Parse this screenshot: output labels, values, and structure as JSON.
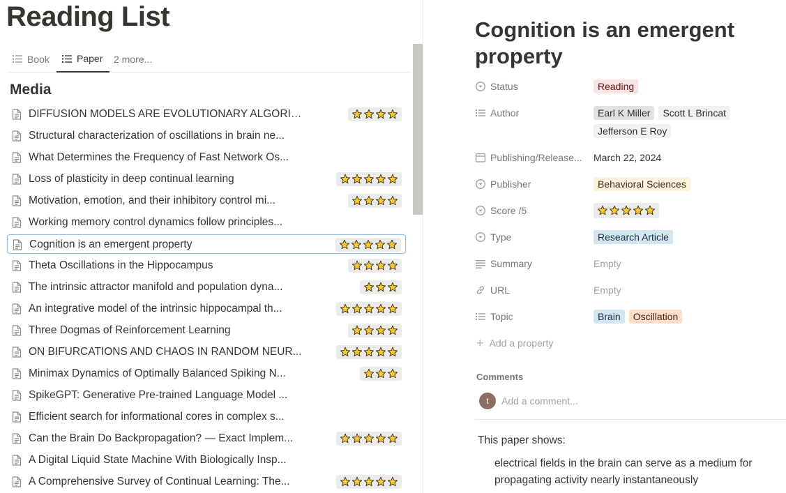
{
  "left": {
    "page_title": "Reading List",
    "tabs": [
      {
        "label": "Book",
        "active": false
      },
      {
        "label": "Paper",
        "active": true
      },
      {
        "label": "2 more...",
        "active": false
      }
    ],
    "section_heading": "Media",
    "rows": [
      {
        "title": "DIFFUSION MODELS ARE EVOLUTIONARY ALGORIT...",
        "stars": 4
      },
      {
        "title": "Structural characterization of oscillations in brain ne...",
        "stars": 0
      },
      {
        "title": "What Determines the Frequency of Fast Network Os...",
        "stars": 0
      },
      {
        "title": "Loss of plasticity in deep continual learning",
        "stars": 5
      },
      {
        "title": "Motivation, emotion, and their inhibitory control mi...",
        "stars": 4
      },
      {
        "title": "Working memory control dynamics follow principles...",
        "stars": 0
      },
      {
        "title": "Cognition is an emergent property",
        "stars": 5,
        "selected": true
      },
      {
        "title": "Theta Oscillations in the Hippocampus",
        "stars": 4
      },
      {
        "title": "The intrinsic attractor manifold and population dyna...",
        "stars": 3
      },
      {
        "title": "An integrative model of the intrinsic hippocampal th...",
        "stars": 5
      },
      {
        "title": "Three Dogmas of Reinforcement Learning",
        "stars": 4
      },
      {
        "title": "ON BIFURCATIONS AND CHAOS IN RANDOM NEUR...",
        "stars": 5
      },
      {
        "title": "Minimax Dynamics of Optimally Balanced Spiking N...",
        "stars": 3
      },
      {
        "title": "SpikeGPT: Generative Pre-trained Language Model ...",
        "stars": 0
      },
      {
        "title": "Efficient search for informational cores in complex s...",
        "stars": 0
      },
      {
        "title": "Can the Brain Do Backpropagation? — Exact Implem...",
        "stars": 5
      },
      {
        "title": "A Digital Liquid State Machine With Biologically Insp...",
        "stars": 0
      },
      {
        "title": "A Comprehensive Survey of Continual Learning: The...",
        "stars": 5
      }
    ]
  },
  "right": {
    "title": "Cognition is an emergent property",
    "properties": {
      "status": {
        "label": "Status",
        "value": "Reading"
      },
      "author": {
        "label": "Author",
        "values": [
          "Earl K Miller",
          "Scott L Brincat",
          "Jefferson E Roy"
        ]
      },
      "publishing": {
        "label": "Publishing/Release...",
        "value": "March 22, 2024"
      },
      "publisher": {
        "label": "Publisher",
        "value": "Behavioral Sciences"
      },
      "score": {
        "label": "Score /5",
        "stars": 5
      },
      "type": {
        "label": "Type",
        "value": "Research Article"
      },
      "summary": {
        "label": "Summary",
        "value": "Empty"
      },
      "url": {
        "label": "URL",
        "value": "Empty"
      },
      "topic": {
        "label": "Topic",
        "values": [
          "Brain",
          "Oscillation"
        ]
      }
    },
    "add_property": "Add a property",
    "comments_label": "Comments",
    "avatar_initial": "t",
    "comment_placeholder": "Add a comment...",
    "body_intro": "This paper shows:",
    "body_bullet": "electrical fields in the brain can serve as a medium for propagating activity nearly instantaneously"
  },
  "icons": {
    "star": "star-icon",
    "doc": "page-icon",
    "list": "list-view-icon"
  },
  "colors": {
    "text": "#37352f",
    "muted": "#787774",
    "star_fill": "#f9c835",
    "selection_border": "#8fc1ea"
  }
}
